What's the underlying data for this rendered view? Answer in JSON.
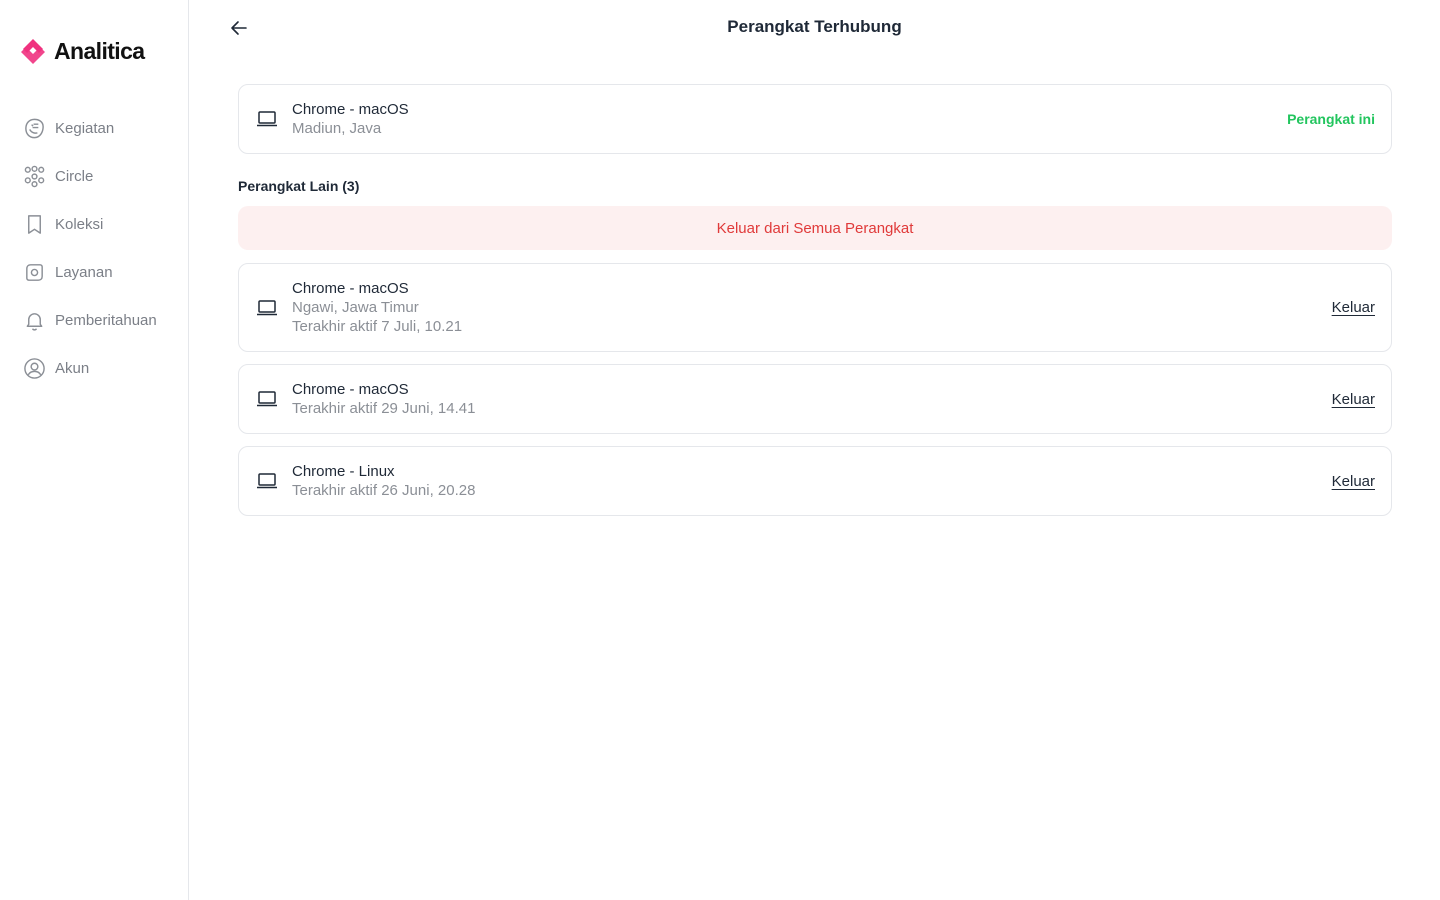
{
  "brand": {
    "name": "Analitica",
    "logo_icon": "analitica-logo",
    "accent": "#f0327f"
  },
  "sidebar": {
    "items": [
      {
        "label": "Kegiatan",
        "icon": "activity-icon"
      },
      {
        "label": "Circle",
        "icon": "circle-group-icon"
      },
      {
        "label": "Koleksi",
        "icon": "bookmark-icon"
      },
      {
        "label": "Layanan",
        "icon": "compass-icon"
      },
      {
        "label": "Pemberitahuan",
        "icon": "bell-icon"
      },
      {
        "label": "Akun",
        "icon": "user-circle-icon"
      }
    ]
  },
  "header": {
    "title": "Perangkat Terhubung",
    "back_icon": "arrow-left-icon"
  },
  "current_device": {
    "name": "Chrome - macOS",
    "location": "Madiun, Java",
    "badge": "Perangkat ini",
    "badge_color": "#22c55e"
  },
  "other_devices": {
    "section_title": "Perangkat Lain (3)",
    "logout_all_label": "Keluar dari Semua Perangkat",
    "logout_all_color": "#e03a3a",
    "logout_label": "Keluar",
    "items": [
      {
        "name": "Chrome - macOS",
        "location": "Ngawi, Jawa Timur",
        "last_active": "Terakhir aktif 7 Juli, 10.21"
      },
      {
        "name": "Chrome - macOS",
        "last_active": "Terakhir aktif 29 Juni, 14.41"
      },
      {
        "name": "Chrome - Linux",
        "last_active": "Terakhir aktif 26 Juni, 20.28"
      }
    ]
  }
}
